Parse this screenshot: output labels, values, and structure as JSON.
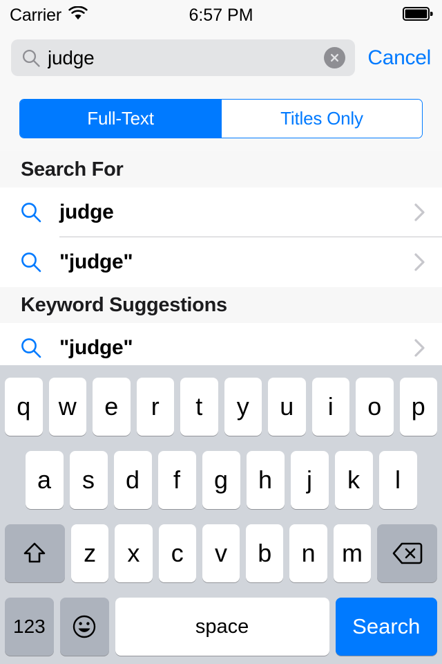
{
  "status_bar": {
    "carrier": "Carrier",
    "wifi_icon": "wifi-icon",
    "time": "6:57 PM",
    "battery_icon": "battery-full-icon"
  },
  "search_bar": {
    "magnifier_icon": "search-icon",
    "value": "judge",
    "placeholder": "Search",
    "clear_icon": "clear-circle-icon",
    "cancel_label": "Cancel"
  },
  "scope_control": {
    "selected_index": 0,
    "options": [
      "Full-Text",
      "Titles Only"
    ]
  },
  "list": {
    "sections": [
      {
        "header": "Search For",
        "rows": [
          {
            "icon": "search-icon",
            "label": "judge",
            "accessory": "chevron-right-icon"
          },
          {
            "icon": "search-icon",
            "label": "\"judge\"",
            "accessory": "chevron-right-icon"
          }
        ]
      },
      {
        "header": "Keyword Suggestions",
        "rows": [
          {
            "icon": "search-icon",
            "label": "\"judge\"",
            "accessory": "chevron-right-icon"
          }
        ]
      }
    ]
  },
  "keyboard": {
    "row1": [
      "q",
      "w",
      "e",
      "r",
      "t",
      "y",
      "u",
      "i",
      "o",
      "p"
    ],
    "row2": [
      "a",
      "s",
      "d",
      "f",
      "g",
      "h",
      "j",
      "k",
      "l"
    ],
    "row3": [
      "z",
      "x",
      "c",
      "v",
      "b",
      "n",
      "m"
    ],
    "shift_icon": "shift-arrow-icon",
    "delete_icon": "backspace-icon",
    "numbers_label": "123",
    "emoji_icon": "smiley-face-icon",
    "space_label": "space",
    "return_label": "Search"
  },
  "colors": {
    "accent_blue": "#007aff",
    "bar_background": "#f8f8f8",
    "field_background": "#e3e4e6",
    "keyboard_background": "#d1d5db",
    "key_white": "#ffffff",
    "key_gray": "#adb3bd",
    "separator": "#c8c7cc",
    "section_header_background": "#f7f7f7",
    "chevron_gray": "#c7c7cc"
  }
}
